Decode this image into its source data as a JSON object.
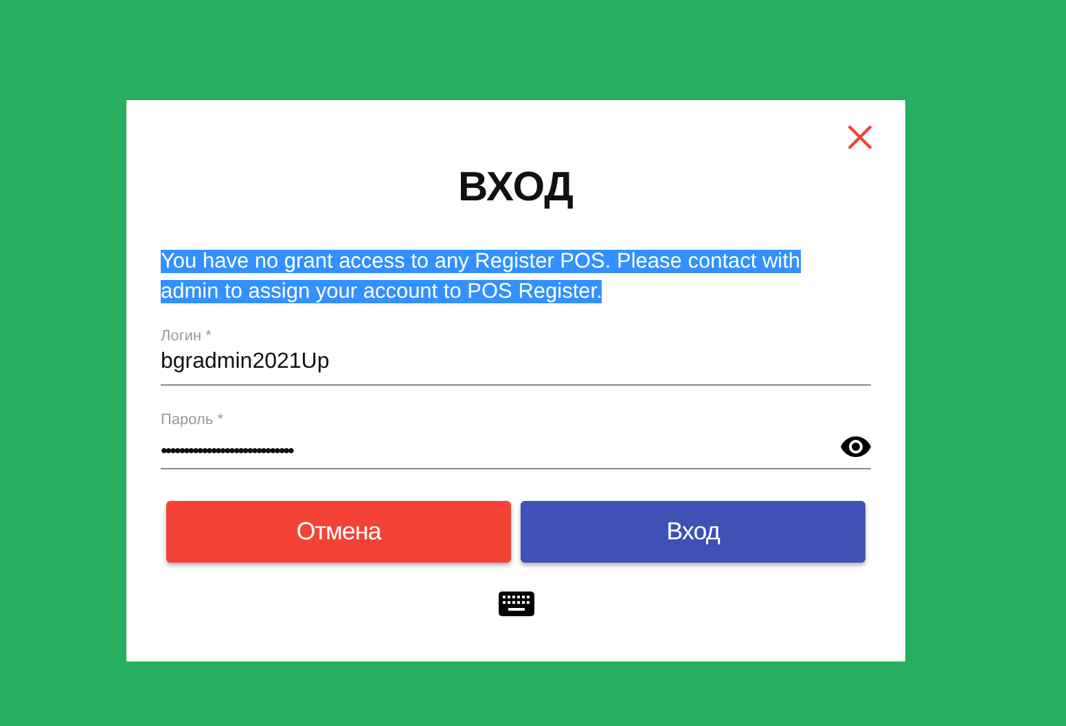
{
  "dialog": {
    "title": "ВХОД",
    "message": {
      "text": "You have no grant access to any Register POS. Please contact with admin to assign your account to POS Register.",
      "highlighted": true
    }
  },
  "fields": [
    {
      "label": "Логин *",
      "value": "bgradmin2021Up",
      "kind": "text"
    },
    {
      "label": "Пароль *",
      "value": "•••••••••••••••••••••••••••••",
      "kind": "password"
    }
  ],
  "buttons": [
    {
      "label": "Отмена",
      "kind": "cancel"
    },
    {
      "label": "Вход",
      "kind": "primary"
    }
  ]
}
